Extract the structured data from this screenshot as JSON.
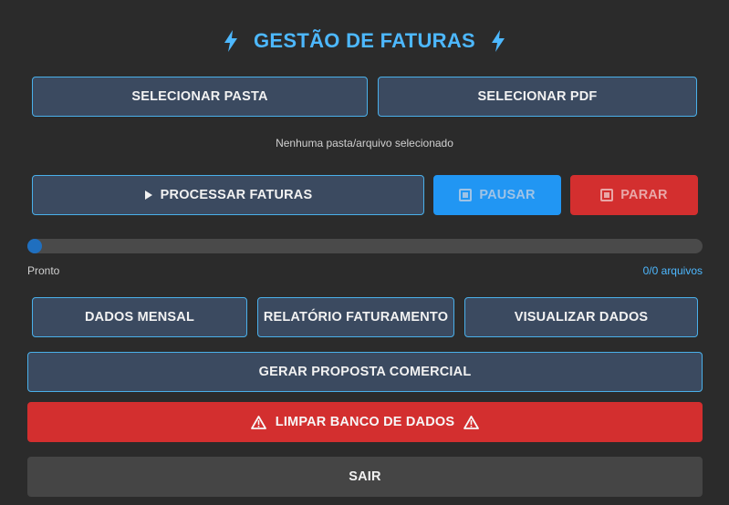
{
  "header": {
    "title": "GESTÃO DE FATURAS",
    "icon": "bolt-icon",
    "accent_color": "#4db8ff"
  },
  "selection": {
    "select_folder_label": "SELECIONAR PASTA",
    "select_pdf_label": "SELECIONAR PDF",
    "status": "Nenhuma pasta/arquivo selecionado"
  },
  "controls": {
    "process_label": "PROCESSAR FATURAS",
    "process_icon": "play-icon",
    "pause_label": "PAUSAR",
    "pause_icon": "stop-icon",
    "stop_label": "PARAR",
    "stop_icon": "stop-icon",
    "pause_color": "#2196f3",
    "stop_color": "#d32f2f"
  },
  "progress": {
    "value": 0,
    "status": "Pronto",
    "count": "0/0 arquivos"
  },
  "actions": {
    "monthly_data": "DADOS MENSAL",
    "billing_report": "RELATÓRIO FATURAMENTO",
    "view_data": "VISUALIZAR DADOS",
    "generate_proposal": "GERAR PROPOSTA COMERCIAL",
    "clear_db": "LIMPAR BANCO DE DADOS",
    "clear_db_icon": "warning-icon",
    "exit": "SAIR"
  }
}
